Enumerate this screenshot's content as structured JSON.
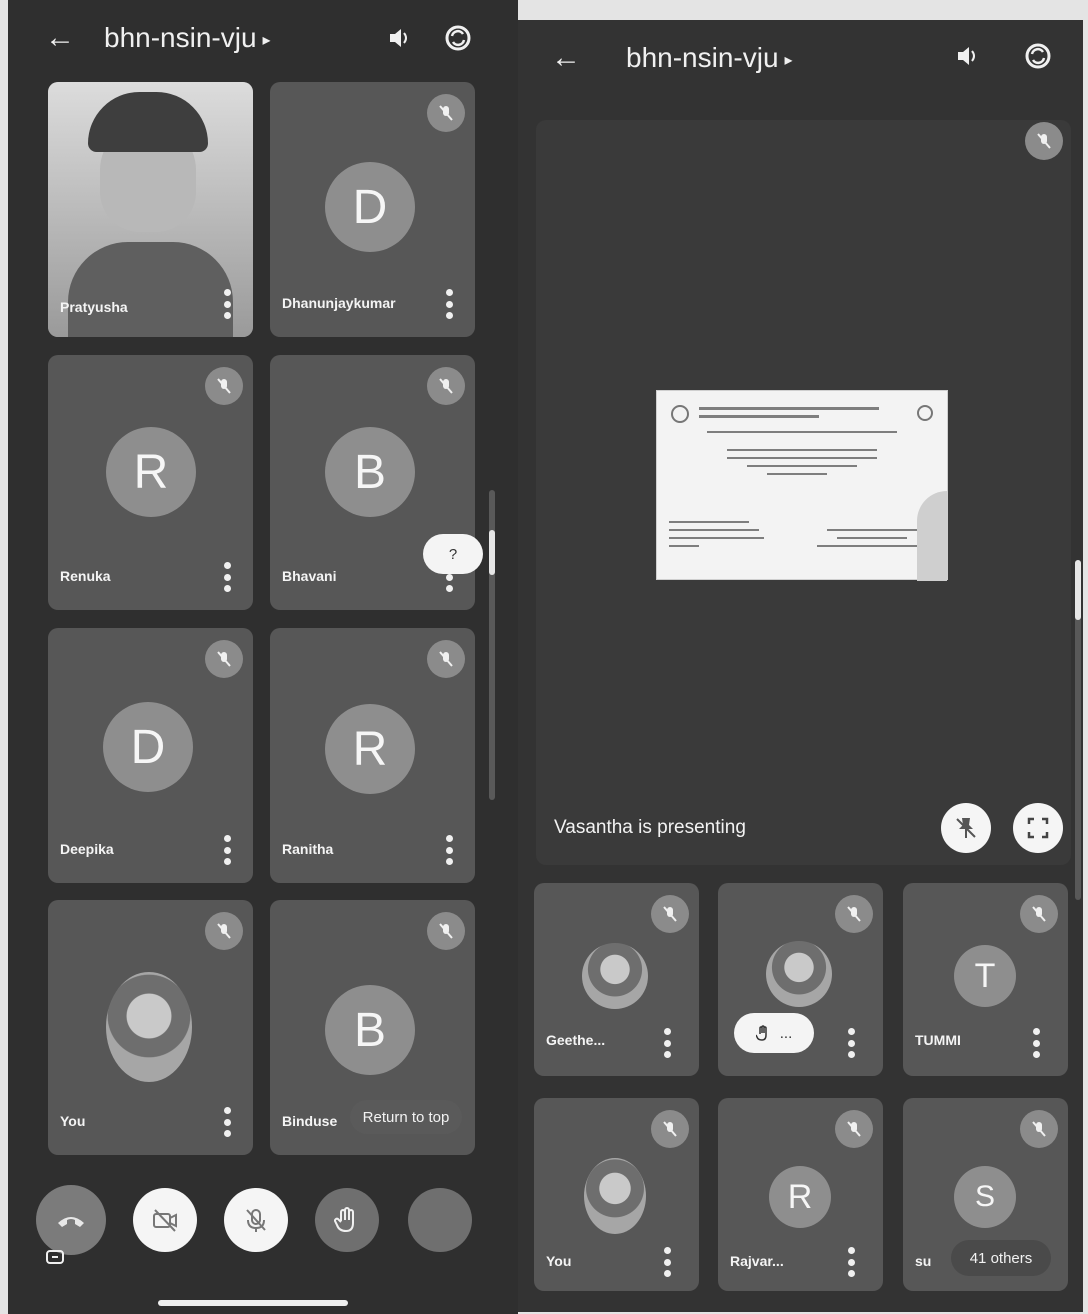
{
  "left_screen": {
    "title": "bhn-nsin-vju",
    "tiles": [
      {
        "name": "Pratyusha",
        "initial": ""
      },
      {
        "name": "Dhanunjaykumar",
        "initial": "D"
      },
      {
        "name": "Renuka",
        "initial": "R"
      },
      {
        "name": "Bhavani",
        "initial": "B"
      },
      {
        "name": "Deepika",
        "initial": "D"
      },
      {
        "name": "Ranitha",
        "initial": "R"
      },
      {
        "name": "You",
        "initial": ""
      },
      {
        "name": "Binduse",
        "initial": "B"
      }
    ],
    "return_to_top": "Return to top",
    "scroll_tooltip": "?"
  },
  "right_screen": {
    "title": "bhn-nsin-vju",
    "presenting_label": "Vasantha is presenting",
    "tiles": [
      {
        "name": "Geethe...",
        "initial": ""
      },
      {
        "name": "",
        "initial": "",
        "raised_hand": "..."
      },
      {
        "name": "TUMMI",
        "initial": "T"
      },
      {
        "name": "You",
        "initial": ""
      },
      {
        "name": "Rajvar...",
        "initial": "R"
      },
      {
        "name": "su",
        "initial": "S"
      }
    ],
    "others_chip": "41 others"
  },
  "icons": [
    "back-arrow-icon",
    "speaker-icon",
    "switch-camera-icon",
    "mic-off-icon",
    "more-vert-icon",
    "hang-up-icon",
    "camera-off-icon",
    "raise-hand-icon",
    "unpin-icon",
    "fullscreen-icon"
  ]
}
